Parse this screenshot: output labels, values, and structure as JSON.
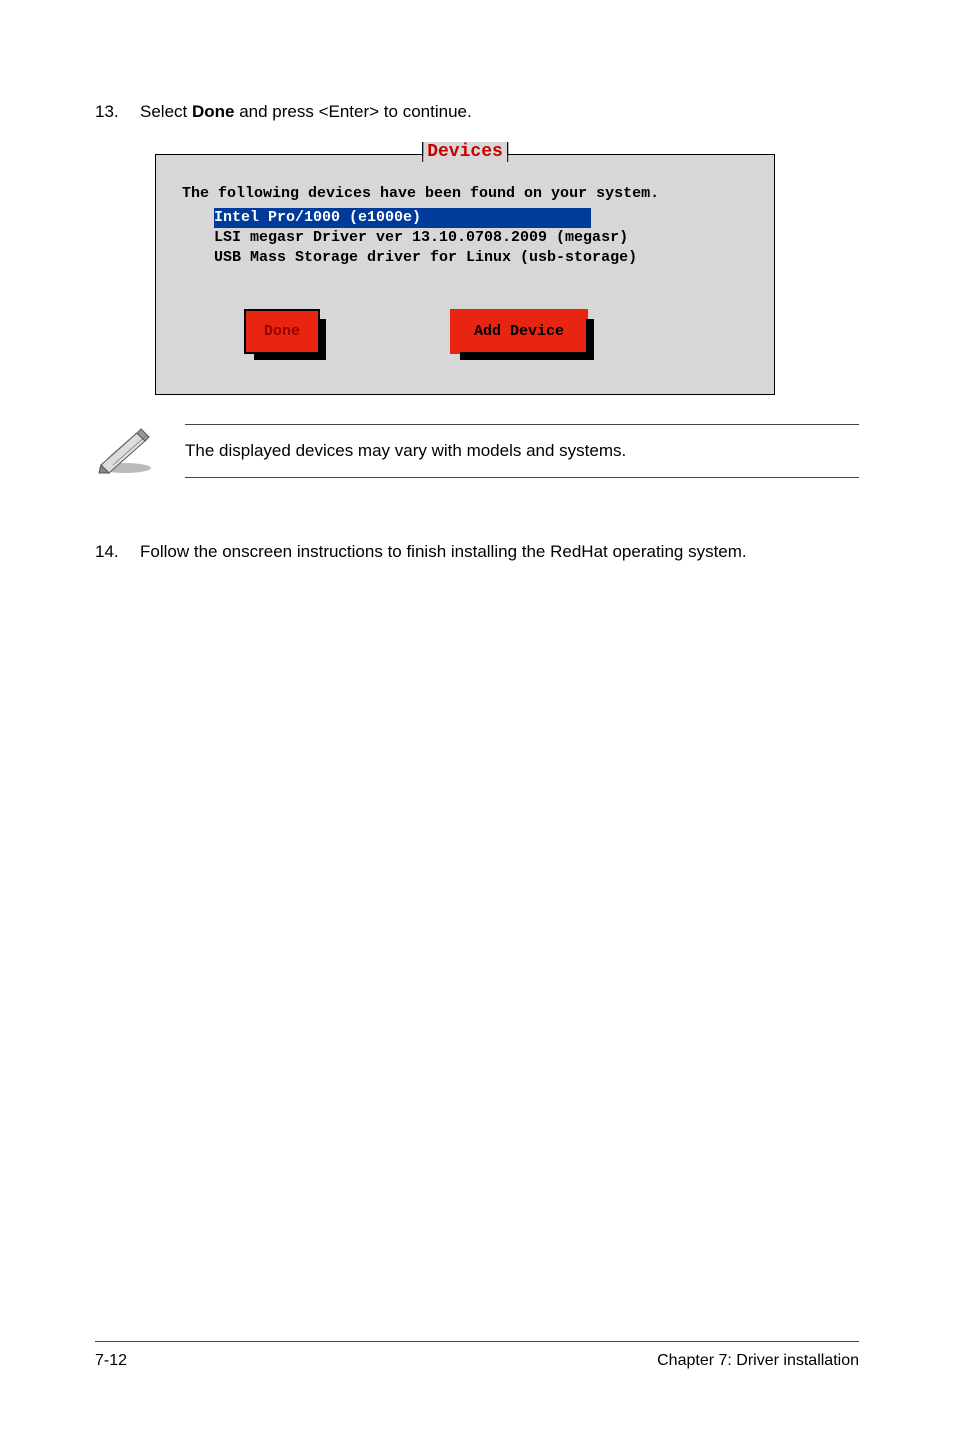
{
  "steps": {
    "s13": {
      "num": "13.",
      "pre": "Select ",
      "done_label": "Done",
      "post": " and press <Enter> to continue."
    },
    "s14": {
      "num": "14.",
      "text": "Follow the onscreen instructions to finish installing the RedHat operating system."
    }
  },
  "dialog": {
    "title": "Devices",
    "intro": "The following devices have been found on your system.",
    "rows": [
      "Intel Pro/1000 (e1000e)",
      "LSI megasr Driver ver 13.10.0708.2009 (megasr)",
      "USB Mass Storage driver for Linux (usb-storage)"
    ],
    "done": "Done",
    "add": "Add Device"
  },
  "note": "The displayed devices may vary with models and systems.",
  "footer": {
    "left": "7-12",
    "right": "Chapter 7: Driver installation"
  }
}
